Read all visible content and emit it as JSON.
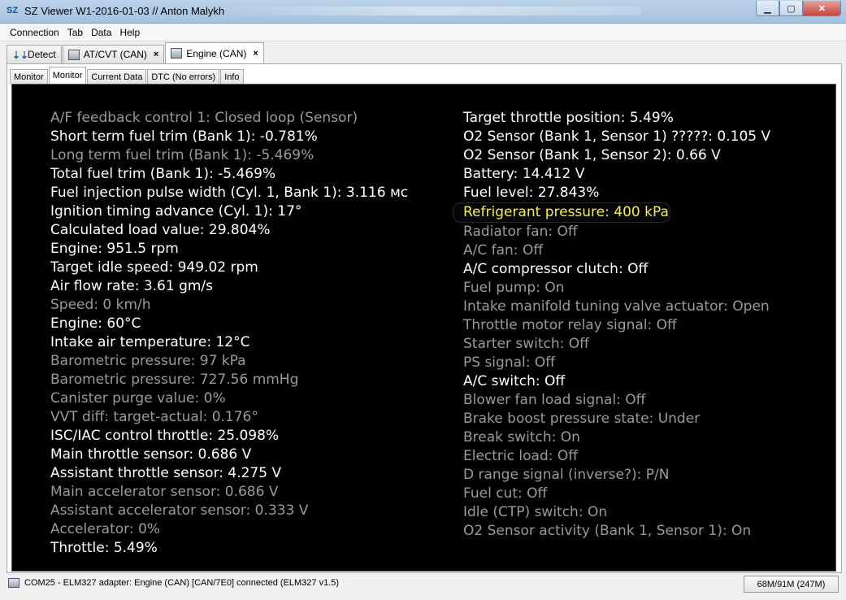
{
  "window": {
    "title": "SZ Viewer W1-2016-01-03 // Anton Malykh",
    "app_icon": "SZ",
    "controls": {
      "minimize": "▁",
      "maximize": "▢",
      "close": "✕"
    }
  },
  "menu": [
    "Connection",
    "Tab",
    "Data",
    "Help"
  ],
  "main_tabs": [
    {
      "label": "Detect",
      "icon": "detect-icon"
    },
    {
      "label": "AT/CVT (CAN)",
      "icon": "ecu-icon",
      "close": "×"
    },
    {
      "label": "Engine (CAN)",
      "icon": "ecu-icon",
      "close": "×",
      "active": true
    }
  ],
  "sub_tabs": [
    {
      "label": "Monitor"
    },
    {
      "label": "Monitor",
      "active": true
    },
    {
      "label": "Current Data"
    },
    {
      "label": "DTC (No errors)"
    },
    {
      "label": "Info"
    }
  ],
  "monitor": {
    "colors": {
      "background": "#000000",
      "bright": "#ffffff",
      "dim": "#9a9a9a",
      "highlight": "#f6ef4a"
    },
    "left": [
      {
        "text": "A/F feedback control 1: Closed loop (Sensor)",
        "style": "dim"
      },
      {
        "text": "Short term fuel trim (Bank 1): -0.781%",
        "style": "bright"
      },
      {
        "text": "Long term fuel trim (Bank 1): -5.469%",
        "style": "dim"
      },
      {
        "text": "Total fuel trim (Bank 1): -5.469%",
        "style": "bright"
      },
      {
        "text": "Fuel injection pulse width (Cyl. 1, Bank 1): 3.116 мс",
        "style": "bright"
      },
      {
        "text": "Ignition timing advance (Cyl. 1): 17°",
        "style": "bright"
      },
      {
        "text": "Calculated load value: 29.804%",
        "style": "bright"
      },
      {
        "text": "Engine: 951.5 rpm",
        "style": "bright"
      },
      {
        "text": "Target idle speed: 949.02 rpm",
        "style": "bright"
      },
      {
        "text": "Air flow rate: 3.61 gm/s",
        "style": "bright"
      },
      {
        "text": "Speed: 0 km/h",
        "style": "dim"
      },
      {
        "text": "Engine: 60°C",
        "style": "bright"
      },
      {
        "text": "Intake air temperature: 12°C",
        "style": "bright"
      },
      {
        "text": "Barometric pressure: 97 kPa",
        "style": "dim"
      },
      {
        "text": "Barometric pressure: 727.56 mmHg",
        "style": "dim"
      },
      {
        "text": "Canister purge value: 0%",
        "style": "dim"
      },
      {
        "text": "VVT diff: target-actual: 0.176°",
        "style": "dim"
      },
      {
        "text": "ISC/IAC control throttle: 25.098%",
        "style": "bright"
      },
      {
        "text": "Main throttle sensor: 0.686 V",
        "style": "bright"
      },
      {
        "text": "Assistant throttle sensor: 4.275 V",
        "style": "bright"
      },
      {
        "text": "Main accelerator sensor: 0.686 V",
        "style": "dim"
      },
      {
        "text": "Assistant accelerator sensor: 0.333 V",
        "style": "dim"
      },
      {
        "text": "Accelerator: 0%",
        "style": "dim"
      },
      {
        "text": "Throttle: 5.49%",
        "style": "bright"
      }
    ],
    "right": [
      {
        "text": "Target throttle position: 5.49%",
        "style": "bright"
      },
      {
        "text": "O2 Sensor (Bank 1, Sensor 1) ?????: 0.105 V",
        "style": "bright"
      },
      {
        "text": "O2 Sensor (Bank 1, Sensor 2): 0.66 V",
        "style": "bright"
      },
      {
        "text": "Battery: 14.412 V",
        "style": "bright"
      },
      {
        "text": "Fuel level: 27.843%",
        "style": "bright"
      },
      {
        "text": "Refrigerant pressure: 400 kPa",
        "style": "highlight"
      },
      {
        "text": "Radiator fan: Off",
        "style": "dim"
      },
      {
        "text": "A/C fan: Off",
        "style": "dim"
      },
      {
        "text": "A/C compressor clutch: Off",
        "style": "bright"
      },
      {
        "text": "Fuel pump: On",
        "style": "dim"
      },
      {
        "text": "Intake manifold tuning valve actuator: Open",
        "style": "dim"
      },
      {
        "text": "Throttle motor relay signal: Off",
        "style": "dim"
      },
      {
        "text": "Starter switch: Off",
        "style": "dim"
      },
      {
        "text": "PS signal: Off",
        "style": "dim"
      },
      {
        "text": "A/C switch: Off",
        "style": "bright"
      },
      {
        "text": "Blower fan load signal: Off",
        "style": "dim"
      },
      {
        "text": "Brake boost pressure state: Under",
        "style": "dim"
      },
      {
        "text": "Break switch: On",
        "style": "dim"
      },
      {
        "text": "Electric load: Off",
        "style": "dim"
      },
      {
        "text": "D range signal (inverse?): P/N",
        "style": "dim"
      },
      {
        "text": "Fuel cut: Off",
        "style": "dim"
      },
      {
        "text": "Idle (CTP) switch: On",
        "style": "dim"
      },
      {
        "text": "O2 Sensor activity (Bank 1, Sensor 1): On",
        "style": "dim"
      }
    ]
  },
  "status": {
    "text": "COM25 - ELM327 adapter: Engine (CAN) [CAN/7E0] connected (ELM327 v1.5)",
    "memory": "68M/91M (247M)"
  }
}
